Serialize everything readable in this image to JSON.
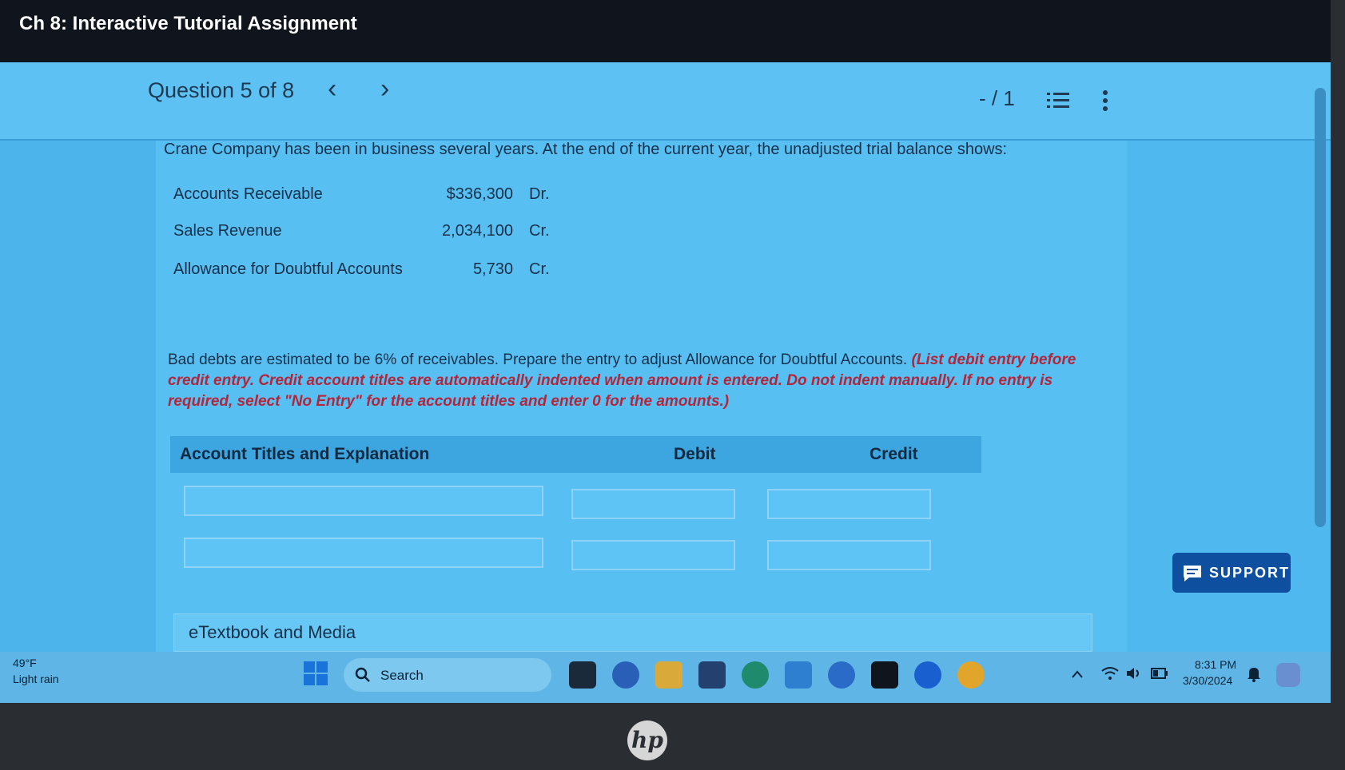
{
  "window": {
    "title": "Ch 8: Interactive Tutorial Assignment"
  },
  "question": {
    "label": "Question 5 of 8",
    "prev": "‹",
    "next": "›",
    "score": "- / 1"
  },
  "problem": {
    "intro": "Crane Company has been in business several years. At the end of the current year, the unadjusted trial balance shows:",
    "trial_balance": [
      {
        "account": "Accounts Receivable",
        "amount": "$336,300",
        "side": "Dr."
      },
      {
        "account": "Sales Revenue",
        "amount": "2,034,100",
        "side": "Cr."
      },
      {
        "account": "Allowance for Doubtful Accounts",
        "amount": "5,730",
        "side": "Cr."
      }
    ],
    "instruction": "Bad debts are estimated to be 6% of receivables. Prepare the entry to adjust Allowance for Doubtful Accounts.",
    "instruction_note": "(List debit entry before credit entry. Credit account titles are automatically indented when amount is entered. Do not indent manually. If no entry is required, select \"No Entry\" for the account titles and enter 0 for the amounts.)"
  },
  "journal": {
    "headers": {
      "account": "Account Titles and Explanation",
      "debit": "Debit",
      "credit": "Credit"
    },
    "rows": [
      {
        "account": "",
        "debit": "",
        "credit": ""
      },
      {
        "account": "",
        "debit": "",
        "credit": ""
      }
    ]
  },
  "etextbook": {
    "label": "eTextbook and Media"
  },
  "support": {
    "label": "SUPPORT"
  },
  "taskbar": {
    "weather_temp": "49°F",
    "weather_desc": "Light rain",
    "search_label": "Search",
    "time": "8:31 PM",
    "date": "3/30/2024"
  },
  "colors": {
    "titlebar": "#10141c",
    "screen": "#4fb8ee",
    "support": "#0f4fa0",
    "note_red": "#b3263a"
  }
}
